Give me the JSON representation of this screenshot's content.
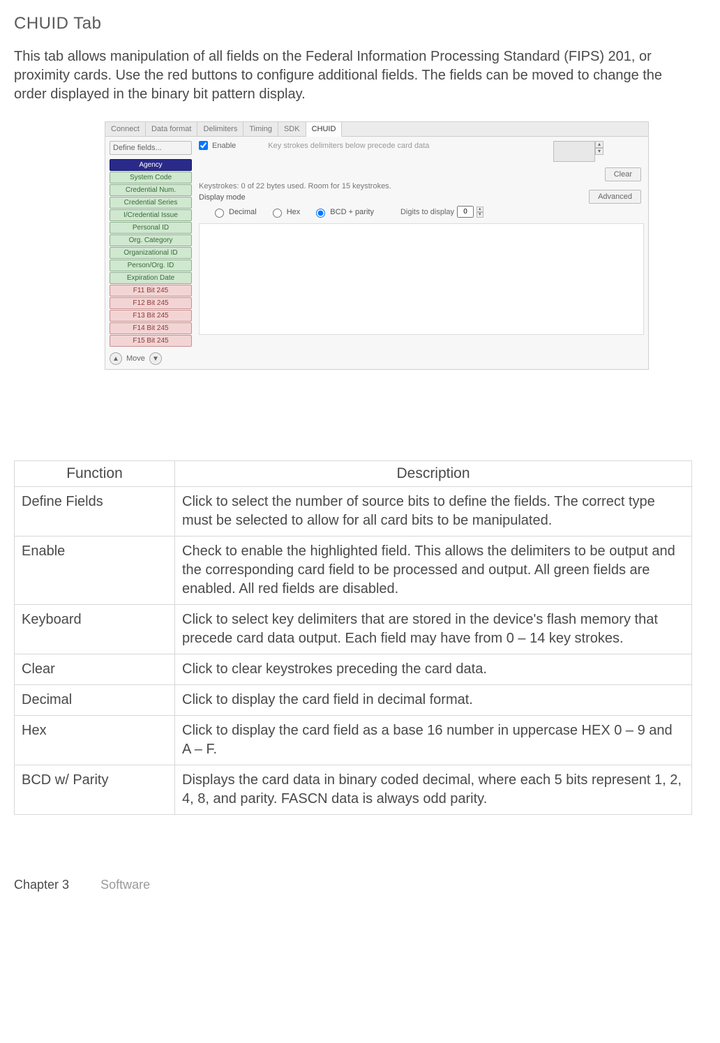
{
  "title": "CHUID Tab",
  "intro": "This tab allows manipulation of all fields on the Federal Information Processing Standard (FIPS) 201, or proximity cards. Use the red buttons to configure additional fields. The fields can be moved to change the order displayed in the binary bit pattern display.",
  "app": {
    "tabs": [
      "Connect",
      "Data format",
      "Delimiters",
      "Timing",
      "SDK",
      "CHUID"
    ],
    "active_tab": "CHUID",
    "define_button": "Define fields...",
    "fields": [
      {
        "label": "Agency",
        "style": "agency"
      },
      {
        "label": "System Code",
        "style": "green"
      },
      {
        "label": "Credential Num.",
        "style": "green"
      },
      {
        "label": "Credential Series",
        "style": "green"
      },
      {
        "label": "I/Credential Issue",
        "style": "green"
      },
      {
        "label": "Personal ID",
        "style": "green"
      },
      {
        "label": "Org. Category",
        "style": "green"
      },
      {
        "label": "Organizational ID",
        "style": "green"
      },
      {
        "label": "Person/Org. ID",
        "style": "green"
      },
      {
        "label": "Expiration Date",
        "style": "green"
      },
      {
        "label": "F11 Bit 245",
        "style": "red"
      },
      {
        "label": "F12 Bit 245",
        "style": "red"
      },
      {
        "label": "F13 Bit 245",
        "style": "red"
      },
      {
        "label": "F14 Bit 245",
        "style": "red"
      },
      {
        "label": "F15 Bit 245",
        "style": "red"
      }
    ],
    "move_label": "Move",
    "enable_label": "Enable",
    "enable_checked": true,
    "note": "Key strokes delimiters below precede card data",
    "clear_button": "Clear",
    "advanced_button": "Advanced",
    "status": "Keystrokes: 0 of 22 bytes used. Room for 15 keystrokes.",
    "display_mode_label": "Display mode",
    "radios": {
      "decimal": "Decimal",
      "hex": "Hex",
      "bcd": "BCD + parity"
    },
    "selected_radio": "bcd",
    "digits_label": "Digits to display",
    "digits_value": "0"
  },
  "table": {
    "headers": [
      "Function",
      "Description"
    ],
    "rows": [
      {
        "fn": "Define Fields",
        "desc": "Click to select the number of source bits to define the fields. The correct type must be selected to allow for all card bits to be manipulated."
      },
      {
        "fn": "Enable",
        "desc": "Check to enable the highlighted field. This allows the delimiters to be output and the corresponding card field to be processed and output. All green fields are enabled. All red fields are disabled."
      },
      {
        "fn": "Keyboard",
        "desc": "Click to select key delimiters that are stored in the device's flash memory that precede card data output. Each field may have from 0 – 14 key strokes."
      },
      {
        "fn": "Clear",
        "desc": "Click to clear keystrokes preceding the card data."
      },
      {
        "fn": "Decimal",
        "desc": "Click to display the card field in decimal format."
      },
      {
        "fn": "Hex",
        "desc": "Click to display the card field as a base 16 number in uppercase HEX 0 – 9 and A – F."
      },
      {
        "fn": "BCD w/ Parity",
        "desc": "Displays the card data in binary coded decimal, where each 5 bits represent 1, 2, 4, 8, and parity. FASCN data is always odd parity."
      }
    ]
  },
  "footer": {
    "chapter": "Chapter 3",
    "section": "Software"
  }
}
